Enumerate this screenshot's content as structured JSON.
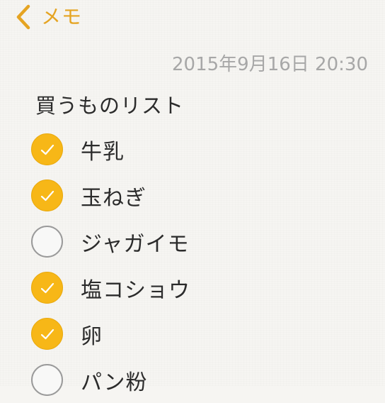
{
  "nav": {
    "back_label": "メモ",
    "accent_color": "#e5a422"
  },
  "note": {
    "timestamp": "2015年9月16日 20:30",
    "title": "買うものリスト",
    "items": [
      {
        "label": "牛乳",
        "checked": true
      },
      {
        "label": "玉ねぎ",
        "checked": true
      },
      {
        "label": "ジャガイモ",
        "checked": false
      },
      {
        "label": "塩コショウ",
        "checked": true
      },
      {
        "label": "卵",
        "checked": true
      },
      {
        "label": "パン粉",
        "checked": false
      }
    ]
  },
  "icons": {
    "back": "chevron-left-icon",
    "checked": "checkmark-icon"
  },
  "colors": {
    "checked_fill": "#f7b717",
    "unchecked_border": "#9a9a9a",
    "timestamp": "#a7a7a7"
  }
}
